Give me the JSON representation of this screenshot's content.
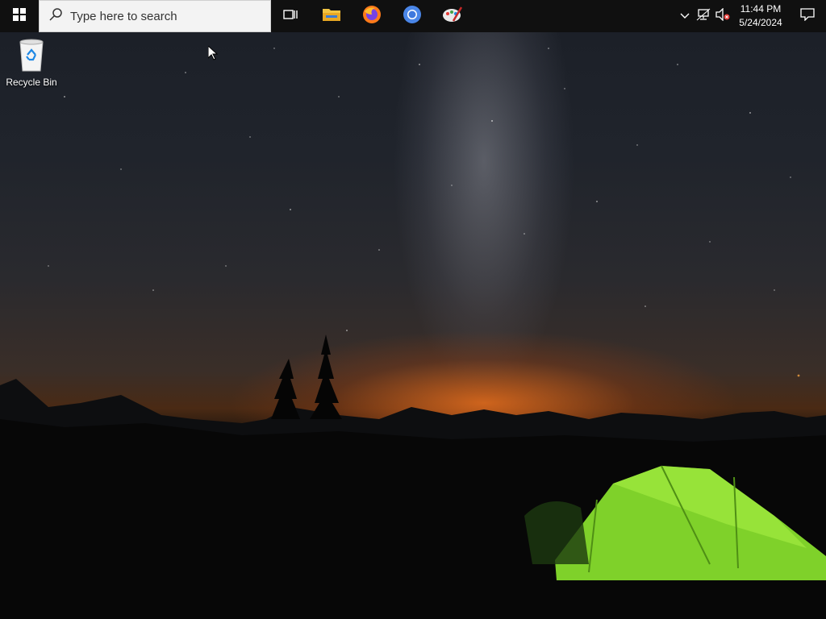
{
  "taskbar": {
    "search": {
      "placeholder": "Type here to search"
    },
    "pinned_apps": [
      {
        "name": "Task View",
        "icon": "task-view-icon"
      },
      {
        "name": "File Explorer",
        "icon": "folder-icon"
      },
      {
        "name": "Firefox",
        "icon": "firefox-icon"
      },
      {
        "name": "Chrome",
        "icon": "chrome-icon"
      },
      {
        "name": "Paint",
        "icon": "paint-icon"
      }
    ],
    "tray": {
      "time": "11:44 PM",
      "date": "5/24/2024"
    }
  },
  "desktop": {
    "icons": [
      {
        "label": "Recycle Bin",
        "icon": "recycle-bin-icon"
      }
    ]
  },
  "colors": {
    "taskbar": "#101010",
    "search_bg": "#f3f3f3",
    "tent": "#8fe02a",
    "horizon": "#e0661e"
  }
}
